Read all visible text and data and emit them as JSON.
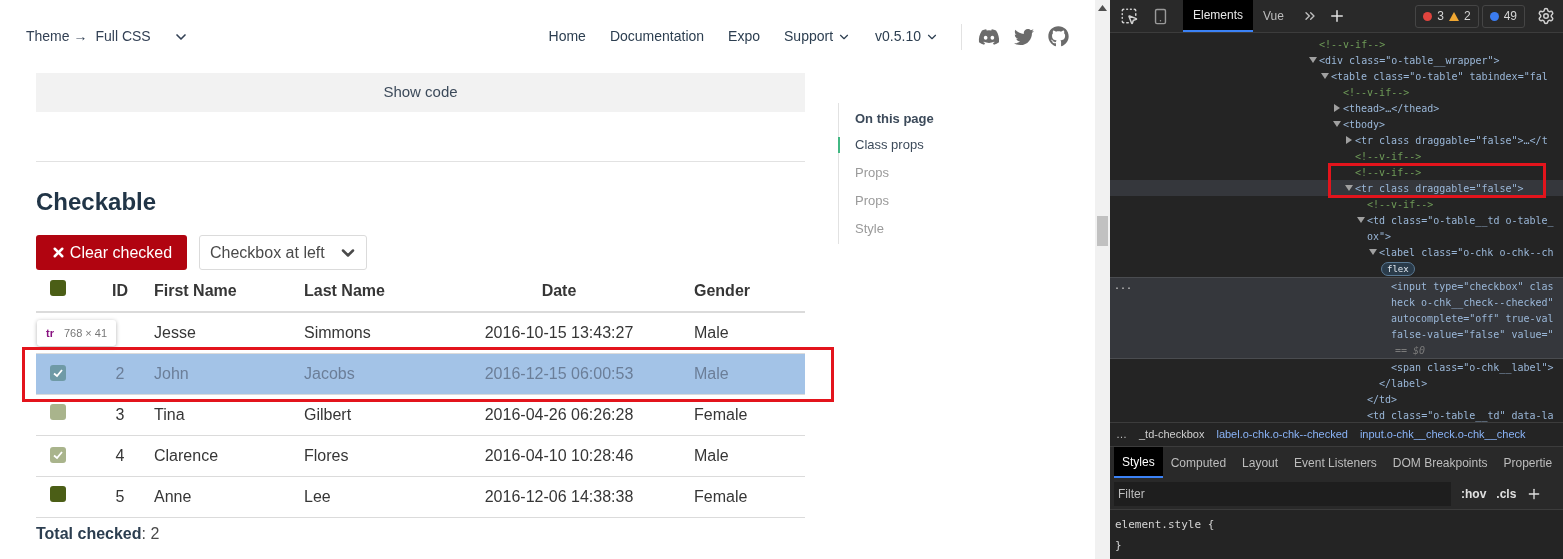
{
  "page": {
    "nav": {
      "theme_label": "Theme →",
      "theme_value": "Full CSS",
      "links": [
        {
          "label": "Home",
          "dropdown": false
        },
        {
          "label": "Documentation",
          "dropdown": false
        },
        {
          "label": "Expo",
          "dropdown": false
        },
        {
          "label": "Support",
          "dropdown": true
        },
        {
          "label": "v0.5.10",
          "dropdown": true
        }
      ]
    },
    "show_code": "Show code",
    "heading": "Checkable",
    "clear_button": "Clear checked",
    "position_select": {
      "value": "Checkbox at left"
    },
    "table": {
      "header_checkbox": {
        "checked": false,
        "color": "#4b5e16"
      },
      "columns": [
        "ID",
        "First Name",
        "Last Name",
        "Date",
        "Gender"
      ],
      "rows": [
        {
          "first_name": "Jesse",
          "last_name": "Simmons",
          "date": "2016-10-15 13:43:27",
          "gender": "Male",
          "highlighted": false
        },
        {
          "id": "2",
          "first_name": "John",
          "last_name": "Jacobs",
          "date": "2016-12-15 06:00:53",
          "gender": "Male",
          "highlighted": true,
          "checkbox": {
            "checked": true,
            "color": "#6f9aa6"
          }
        },
        {
          "id": "3",
          "first_name": "Tina",
          "last_name": "Gilbert",
          "date": "2016-04-26 06:26:28",
          "gender": "Female",
          "highlighted": false,
          "checkbox": {
            "checked": false,
            "color": "#a9b48c"
          }
        },
        {
          "id": "4",
          "first_name": "Clarence",
          "last_name": "Flores",
          "date": "2016-04-10 10:28:46",
          "gender": "Male",
          "highlighted": false,
          "checkbox": {
            "checked": true,
            "color": "#a9b48c"
          }
        },
        {
          "id": "5",
          "first_name": "Anne",
          "last_name": "Lee",
          "date": "2016-12-06 14:38:38",
          "gender": "Female",
          "highlighted": false,
          "checkbox": {
            "checked": false,
            "color": "#4b5e16"
          }
        }
      ]
    },
    "total": "**Total checked**: 2",
    "inspector_tooltip": {
      "tag": "tr",
      "size": "768 × 41"
    },
    "toc": {
      "title": "On this page",
      "items": [
        {
          "label": "Class props",
          "selected": true
        },
        {
          "label": "Props",
          "selected": false
        },
        {
          "label": "Props",
          "selected": false
        },
        {
          "label": "Style",
          "selected": false
        }
      ]
    }
  },
  "devtools": {
    "tabs": [
      {
        "label": "Elements",
        "selected": true
      },
      {
        "label": "Vue",
        "selected": false
      }
    ],
    "counts": {
      "errors": "3",
      "warnings": "2",
      "messages": "49"
    },
    "tree": [
      {
        "kind": "comment",
        "lines": [
          "<!--v-if-->"
        ]
      },
      {
        "kind": "element",
        "expanded": true,
        "lines": [
          "<div class=\"o-table__wrapper\">"
        ],
        "children": [
          {
            "kind": "element",
            "expanded": true,
            "lines": [
              "<table class=\"o-table\" tabindex=\"fal"
            ],
            "children": [
              {
                "kind": "comment",
                "lines": [
                  "<!--v-if-->"
                ]
              },
              {
                "kind": "element",
                "expanded": false,
                "lines": [
                  "<thead>…</thead>"
                ]
              },
              {
                "kind": "element",
                "expanded": true,
                "lines": [
                  "<tbody>"
                ],
                "children": [
                  {
                    "kind": "element",
                    "expanded": false,
                    "lines": [
                      "<tr class draggable=\"false\">…</t"
                    ]
                  },
                  {
                    "kind": "comment",
                    "lines": [
                      "<!--v-if-->"
                    ]
                  },
                  {
                    "kind": "comment",
                    "lines": [
                      "<!--v-if-->"
                    ]
                  },
                  {
                    "kind": "element",
                    "expanded": true,
                    "hovered": true,
                    "lines": [
                      "<tr class draggable=\"false\">"
                    ],
                    "children": [
                      {
                        "kind": "comment",
                        "lines": [
                          "<!--v-if-->"
                        ]
                      },
                      {
                        "kind": "element",
                        "expanded": true,
                        "lines": [
                          "<td class=\"o-table__td o-table_",
                          "ox\">"
                        ],
                        "close": "</td>",
                        "children": [
                          {
                            "kind": "element",
                            "expanded": true,
                            "lines": [
                              "<label class=\"o-chk o-chk--ch"
                            ],
                            "badge": "flex",
                            "close": "</label>",
                            "children": [
                              {
                                "kind": "element",
                                "selected": true,
                                "gutter": "...",
                                "lines": [
                                  "<input type=\"checkbox\" clas",
                                  "heck o-chk__check--checked\"",
                                  "autocomplete=\"off\" true-val",
                                  "false-value=\"false\" value=\""
                                ],
                                "note": "== $0"
                              },
                              {
                                "kind": "element",
                                "lines": [
                                  "<span class=\"o-chk__label\">"
                                ]
                              }
                            ]
                          }
                        ]
                      },
                      {
                        "kind": "element",
                        "lines": [
                          "<td class=\"o-table__td\" data-la"
                        ]
                      }
                    ]
                  }
                ]
              }
            ]
          }
        ]
      }
    ],
    "breadcrumbs": {
      "lead": "…",
      "items": [
        "_td-checkbox",
        "label.o-chk.o-chk--checked",
        "input.o-chk__check.o-chk__check"
      ]
    },
    "pane_tabs": [
      {
        "label": "Styles",
        "selected": true
      },
      {
        "label": "Computed",
        "selected": false
      },
      {
        "label": "Layout",
        "selected": false
      },
      {
        "label": "Event Listeners",
        "selected": false
      },
      {
        "label": "DOM Breakpoints",
        "selected": false
      },
      {
        "label": "Propertie",
        "selected": false
      }
    ],
    "filter": {
      "placeholder": "Filter"
    },
    "style_buttons": [
      ":hov",
      ".cls"
    ],
    "rule": {
      "open": "element.style {",
      "close": "}"
    }
  }
}
